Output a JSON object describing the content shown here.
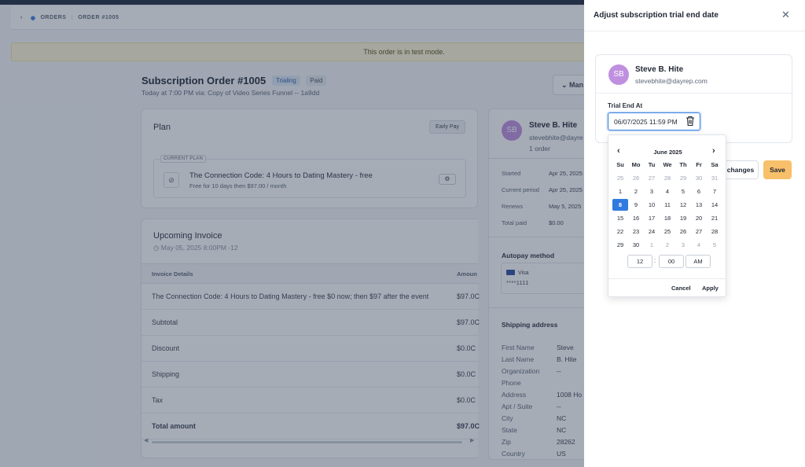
{
  "breadcrumb": {
    "root": "ORDERS",
    "separator": ":",
    "current": "ORDER #1005"
  },
  "banner": {
    "text": "This order is in test mode."
  },
  "order": {
    "title": "Subscription Order #1005",
    "badges": [
      "Trialing",
      "Paid"
    ],
    "subtitle": "Today at 7:00 PM via: Copy of Video Series Funnel -- 1a9dd",
    "manage_label": "Man"
  },
  "plan": {
    "heading": "Plan",
    "early_pay_label": "Early Pay",
    "current_plan_tag": "CURRENT PLAN",
    "name": "The Connection Code: 4 Hours to Dating Mastery - free",
    "terms": "Free for 10 days then $97.00 / month"
  },
  "invoice": {
    "heading": "Upcoming Invoice",
    "date": "May 05, 2025 8:00PM -12",
    "col_details": "Invoice Details",
    "col_amount": "Amoun",
    "rows": [
      {
        "label": "The Connection Code: 4 Hours to Dating Mastery - free $0 now; then $97 after the event",
        "amount": "$97.0C"
      },
      {
        "label": "Subtotal",
        "amount": "$97.0C"
      },
      {
        "label": "Discount",
        "amount": "$0.0C"
      },
      {
        "label": "Shipping",
        "amount": "$0.0C"
      },
      {
        "label": "Tax",
        "amount": "$0.0C"
      },
      {
        "label": "Total amount",
        "amount": "$97.0C"
      }
    ]
  },
  "customer": {
    "initials": "SB",
    "name": "Steve B. Hite",
    "email_truncated": "stevebhite@dayre",
    "orders": "1 order",
    "details": [
      {
        "label": "Started",
        "value": "Apr 25, 2025"
      },
      {
        "label": "Current period",
        "value": "Apr 25, 2025"
      },
      {
        "label": "Renews",
        "value": "May 5, 2025"
      },
      {
        "label": "Total paid",
        "value": "$0.00"
      }
    ],
    "autopay_heading": "Autopay method",
    "card_brand": "Visa",
    "card_digits": "****1111",
    "shipping_heading": "Shipping address",
    "shipping": [
      {
        "label": "First Name",
        "value": "Steve"
      },
      {
        "label": "Last Name",
        "value": "B. Hite"
      },
      {
        "label": "Organization",
        "value": "--"
      },
      {
        "label": "Phone",
        "value": ""
      },
      {
        "label": "Address",
        "value": "1008 Ho"
      },
      {
        "label": "Apt / Suite",
        "value": "--"
      },
      {
        "label": "City",
        "value": "NC"
      },
      {
        "label": "State",
        "value": "NC"
      },
      {
        "label": "Zip",
        "value": "28262"
      },
      {
        "label": "Country",
        "value": "US"
      }
    ]
  },
  "panel": {
    "title": "Adjust subscription trial end date",
    "close_icon": "close-icon",
    "customer_initials": "SB",
    "customer_name": "Steve B. Hite",
    "customer_email": "stevebhite@dayrep.com",
    "field_label": "Trial End At",
    "field_value": "06/07/2025 11:59 PM",
    "changes_label": "changes",
    "save_label": "Save",
    "accent": "#f8c06a"
  },
  "datepicker": {
    "month_label": "June 2025",
    "weekdays": [
      "Su",
      "Mo",
      "Tu",
      "We",
      "Th",
      "Fr",
      "Sa"
    ],
    "weeks": [
      [
        "25",
        "26",
        "27",
        "28",
        "29",
        "30",
        "31"
      ],
      [
        "1",
        "2",
        "3",
        "4",
        "5",
        "6",
        "7"
      ],
      [
        "8",
        "9",
        "10",
        "11",
        "12",
        "13",
        "14"
      ],
      [
        "15",
        "16",
        "17",
        "18",
        "19",
        "20",
        "21"
      ],
      [
        "22",
        "23",
        "24",
        "25",
        "26",
        "27",
        "28"
      ],
      [
        "29",
        "30",
        "1",
        "2",
        "3",
        "4",
        "5"
      ]
    ],
    "muted_first_row": true,
    "muted_last_row_from": 2,
    "selected": "8",
    "hour": "12",
    "minute": "00",
    "meridiem": "AM",
    "cancel_label": "Cancel",
    "apply_label": "Apply",
    "selected_color": "#2f7be0"
  }
}
